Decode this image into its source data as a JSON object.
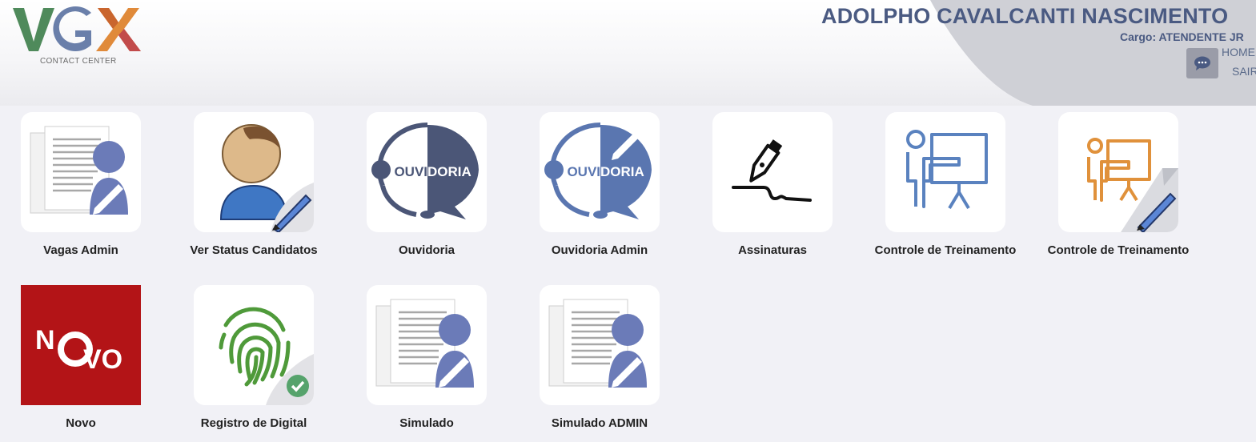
{
  "header": {
    "logo_text": "VGX",
    "logo_subtitle": "CONTACT CENTER",
    "user_name": "ADOLPHO CAVALCANTI NASCIMENTO",
    "user_role": "Cargo: ATENDENTE JR",
    "nav_home": "HOME",
    "nav_exit": "SAIR",
    "chat_icon": "chat-bubble-icon"
  },
  "colors": {
    "user_text": "#4a5a82",
    "logo_v": "#4f8a5b",
    "logo_g": "#6a7faa",
    "logo_x_orange": "#e08a3a",
    "logo_x_red": "#c24b4b",
    "novo_bg": "#b31417"
  },
  "apps": [
    {
      "label": "Vagas Admin",
      "icon": "document-person-edit-icon"
    },
    {
      "label": "Ver Status Candidatos",
      "icon": "person-pen-icon"
    },
    {
      "label": "Ouvidoria",
      "icon": "ouvidoria-speech-icon"
    },
    {
      "label": "Ouvidoria Admin",
      "icon": "ouvidoria-admin-speech-icon"
    },
    {
      "label": "Assinaturas",
      "icon": "signature-pen-icon"
    },
    {
      "label": "Controle de Treinamento",
      "icon": "training-presenter-icon"
    },
    {
      "label": "Controle de Treinamento",
      "icon": "training-presenter-edit-icon"
    },
    {
      "label": "Novo",
      "icon": "novo-badge-icon",
      "badge_text": "NOVO"
    },
    {
      "label": "Registro de Digital",
      "icon": "fingerprint-check-icon"
    },
    {
      "label": "Simulado",
      "icon": "document-person-edit-icon"
    },
    {
      "label": "Simulado ADMIN",
      "icon": "document-person-edit-icon"
    }
  ]
}
